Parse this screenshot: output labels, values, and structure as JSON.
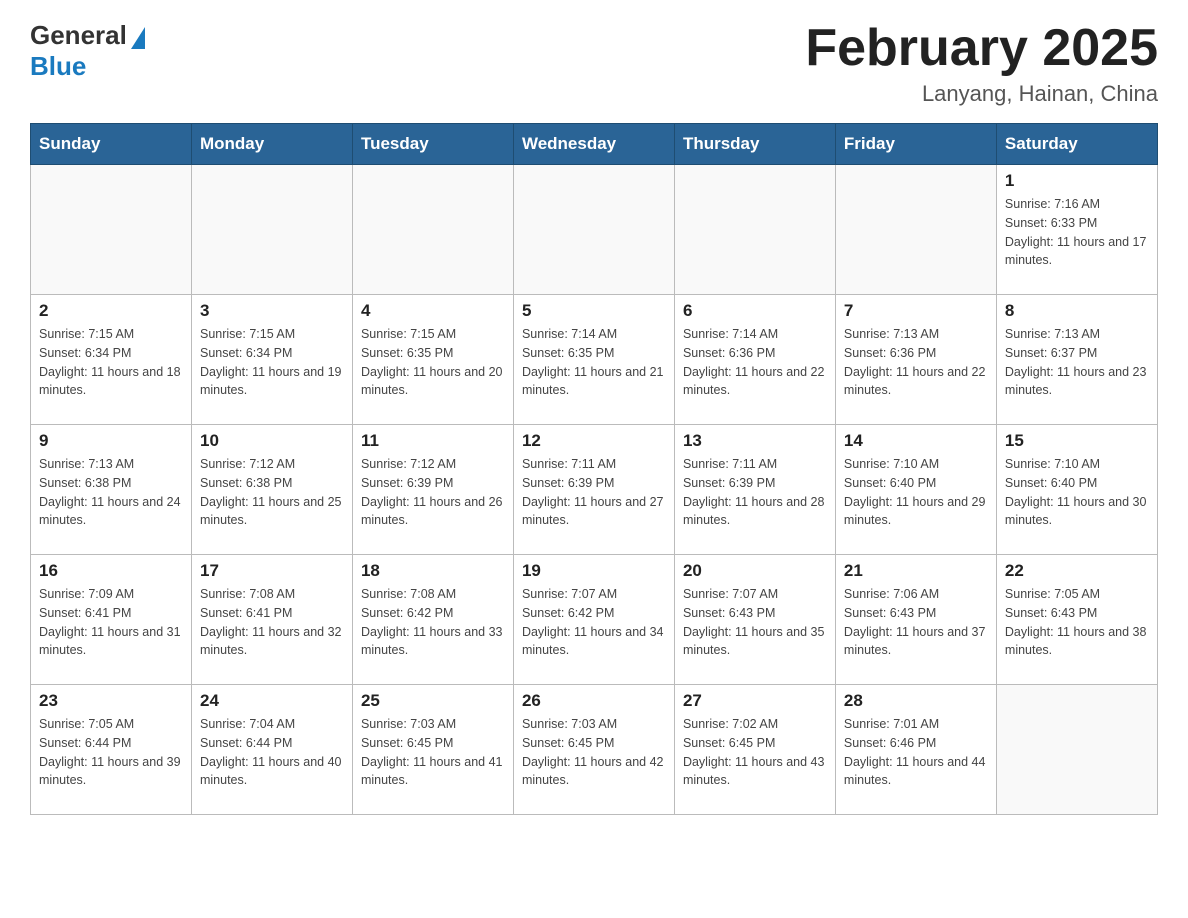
{
  "header": {
    "logo_general": "General",
    "logo_blue": "Blue",
    "month_title": "February 2025",
    "location": "Lanyang, Hainan, China"
  },
  "weekdays": [
    "Sunday",
    "Monday",
    "Tuesday",
    "Wednesday",
    "Thursday",
    "Friday",
    "Saturday"
  ],
  "weeks": [
    [
      {
        "day": "",
        "sunrise": "",
        "sunset": "",
        "daylight": ""
      },
      {
        "day": "",
        "sunrise": "",
        "sunset": "",
        "daylight": ""
      },
      {
        "day": "",
        "sunrise": "",
        "sunset": "",
        "daylight": ""
      },
      {
        "day": "",
        "sunrise": "",
        "sunset": "",
        "daylight": ""
      },
      {
        "day": "",
        "sunrise": "",
        "sunset": "",
        "daylight": ""
      },
      {
        "day": "",
        "sunrise": "",
        "sunset": "",
        "daylight": ""
      },
      {
        "day": "1",
        "sunrise": "Sunrise: 7:16 AM",
        "sunset": "Sunset: 6:33 PM",
        "daylight": "Daylight: 11 hours and 17 minutes."
      }
    ],
    [
      {
        "day": "2",
        "sunrise": "Sunrise: 7:15 AM",
        "sunset": "Sunset: 6:34 PM",
        "daylight": "Daylight: 11 hours and 18 minutes."
      },
      {
        "day": "3",
        "sunrise": "Sunrise: 7:15 AM",
        "sunset": "Sunset: 6:34 PM",
        "daylight": "Daylight: 11 hours and 19 minutes."
      },
      {
        "day": "4",
        "sunrise": "Sunrise: 7:15 AM",
        "sunset": "Sunset: 6:35 PM",
        "daylight": "Daylight: 11 hours and 20 minutes."
      },
      {
        "day": "5",
        "sunrise": "Sunrise: 7:14 AM",
        "sunset": "Sunset: 6:35 PM",
        "daylight": "Daylight: 11 hours and 21 minutes."
      },
      {
        "day": "6",
        "sunrise": "Sunrise: 7:14 AM",
        "sunset": "Sunset: 6:36 PM",
        "daylight": "Daylight: 11 hours and 22 minutes."
      },
      {
        "day": "7",
        "sunrise": "Sunrise: 7:13 AM",
        "sunset": "Sunset: 6:36 PM",
        "daylight": "Daylight: 11 hours and 22 minutes."
      },
      {
        "day": "8",
        "sunrise": "Sunrise: 7:13 AM",
        "sunset": "Sunset: 6:37 PM",
        "daylight": "Daylight: 11 hours and 23 minutes."
      }
    ],
    [
      {
        "day": "9",
        "sunrise": "Sunrise: 7:13 AM",
        "sunset": "Sunset: 6:38 PM",
        "daylight": "Daylight: 11 hours and 24 minutes."
      },
      {
        "day": "10",
        "sunrise": "Sunrise: 7:12 AM",
        "sunset": "Sunset: 6:38 PM",
        "daylight": "Daylight: 11 hours and 25 minutes."
      },
      {
        "day": "11",
        "sunrise": "Sunrise: 7:12 AM",
        "sunset": "Sunset: 6:39 PM",
        "daylight": "Daylight: 11 hours and 26 minutes."
      },
      {
        "day": "12",
        "sunrise": "Sunrise: 7:11 AM",
        "sunset": "Sunset: 6:39 PM",
        "daylight": "Daylight: 11 hours and 27 minutes."
      },
      {
        "day": "13",
        "sunrise": "Sunrise: 7:11 AM",
        "sunset": "Sunset: 6:39 PM",
        "daylight": "Daylight: 11 hours and 28 minutes."
      },
      {
        "day": "14",
        "sunrise": "Sunrise: 7:10 AM",
        "sunset": "Sunset: 6:40 PM",
        "daylight": "Daylight: 11 hours and 29 minutes."
      },
      {
        "day": "15",
        "sunrise": "Sunrise: 7:10 AM",
        "sunset": "Sunset: 6:40 PM",
        "daylight": "Daylight: 11 hours and 30 minutes."
      }
    ],
    [
      {
        "day": "16",
        "sunrise": "Sunrise: 7:09 AM",
        "sunset": "Sunset: 6:41 PM",
        "daylight": "Daylight: 11 hours and 31 minutes."
      },
      {
        "day": "17",
        "sunrise": "Sunrise: 7:08 AM",
        "sunset": "Sunset: 6:41 PM",
        "daylight": "Daylight: 11 hours and 32 minutes."
      },
      {
        "day": "18",
        "sunrise": "Sunrise: 7:08 AM",
        "sunset": "Sunset: 6:42 PM",
        "daylight": "Daylight: 11 hours and 33 minutes."
      },
      {
        "day": "19",
        "sunrise": "Sunrise: 7:07 AM",
        "sunset": "Sunset: 6:42 PM",
        "daylight": "Daylight: 11 hours and 34 minutes."
      },
      {
        "day": "20",
        "sunrise": "Sunrise: 7:07 AM",
        "sunset": "Sunset: 6:43 PM",
        "daylight": "Daylight: 11 hours and 35 minutes."
      },
      {
        "day": "21",
        "sunrise": "Sunrise: 7:06 AM",
        "sunset": "Sunset: 6:43 PM",
        "daylight": "Daylight: 11 hours and 37 minutes."
      },
      {
        "day": "22",
        "sunrise": "Sunrise: 7:05 AM",
        "sunset": "Sunset: 6:43 PM",
        "daylight": "Daylight: 11 hours and 38 minutes."
      }
    ],
    [
      {
        "day": "23",
        "sunrise": "Sunrise: 7:05 AM",
        "sunset": "Sunset: 6:44 PM",
        "daylight": "Daylight: 11 hours and 39 minutes."
      },
      {
        "day": "24",
        "sunrise": "Sunrise: 7:04 AM",
        "sunset": "Sunset: 6:44 PM",
        "daylight": "Daylight: 11 hours and 40 minutes."
      },
      {
        "day": "25",
        "sunrise": "Sunrise: 7:03 AM",
        "sunset": "Sunset: 6:45 PM",
        "daylight": "Daylight: 11 hours and 41 minutes."
      },
      {
        "day": "26",
        "sunrise": "Sunrise: 7:03 AM",
        "sunset": "Sunset: 6:45 PM",
        "daylight": "Daylight: 11 hours and 42 minutes."
      },
      {
        "day": "27",
        "sunrise": "Sunrise: 7:02 AM",
        "sunset": "Sunset: 6:45 PM",
        "daylight": "Daylight: 11 hours and 43 minutes."
      },
      {
        "day": "28",
        "sunrise": "Sunrise: 7:01 AM",
        "sunset": "Sunset: 6:46 PM",
        "daylight": "Daylight: 11 hours and 44 minutes."
      },
      {
        "day": "",
        "sunrise": "",
        "sunset": "",
        "daylight": ""
      }
    ]
  ]
}
